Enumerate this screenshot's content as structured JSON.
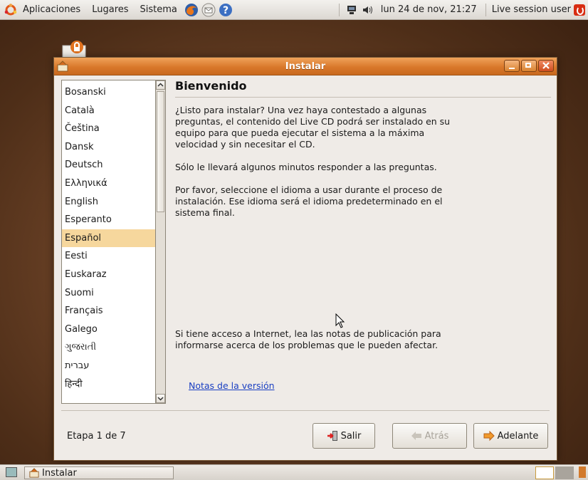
{
  "top_panel": {
    "menus": [
      "Aplicaciones",
      "Lugares",
      "Sistema"
    ],
    "clock": "lun 24 de nov, 21:27",
    "user": "Live session user"
  },
  "window": {
    "title": "Instalar",
    "languages": [
      "Bosanski",
      "Català",
      "Čeština",
      "Dansk",
      "Deutsch",
      "Ελληνικά",
      "English",
      "Esperanto",
      "Español",
      "Eesti",
      "Euskaraz",
      "Suomi",
      "Français",
      "Galego",
      "ગુજરાતી",
      "עברית",
      "हिन्दी"
    ],
    "selected_language": "Español",
    "heading": "Bienvenido",
    "paragraphs": [
      "¿Listo para instalar? Una vez haya contestado a algunas preguntas, el contenido del Live CD podrá ser instalado en su equipo para que pueda ejecutar el sistema a la máxima velocidad y sin necesitar el CD.",
      "Sólo le llevará algunos minutos responder a las preguntas.",
      "Por favor, seleccione el idioma a usar durante el proceso de instalación. Ese idioma será el idioma predeterminado en el sistema final."
    ],
    "internet_note": "Si tiene acceso a Internet, lea las notas de publicación para informarse acerca de los problemas que le pueden afectar.",
    "release_notes_link": "Notas de la versión",
    "step": "Etapa 1 de 7",
    "buttons": {
      "quit": "Salir",
      "back": "Atrás",
      "forward": "Adelante"
    }
  },
  "bottom_panel": {
    "task": "Instalar"
  },
  "colors": {
    "titlebar": "#d9782b",
    "selection": "#f6d79d",
    "link": "#1a3fc2"
  }
}
